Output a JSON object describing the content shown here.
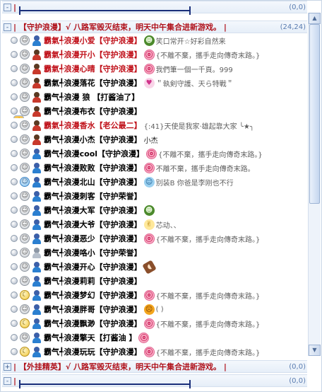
{
  "top_partial": {
    "count": "(0,0)"
  },
  "group1": {
    "expander": "-",
    "title": "| 【守护浪漫】√ 八路军毁灭结束，明天中午集合进新游戏。 |",
    "count": "(24,24)"
  },
  "members": [
    {
      "face": "grey",
      "avatar": "blue",
      "name": "霸氣╃浪漫小爱【守护浪漫】",
      "red": true,
      "icon": "green",
      "icon_glyph": "☻",
      "sig": "笑口常开☆好彩自然来"
    },
    {
      "face": "grey",
      "avatar": "dark",
      "name": "霸氣╃浪漫开小【守护浪漫】",
      "red": true,
      "icon": "pink",
      "icon_glyph": "ⓞ",
      "sig": "{不離不棄，攜手走向傳奇末路。}"
    },
    {
      "face": "grey",
      "avatar": "dark",
      "name": "霸氣╃浪漫心晴【守护浪漫】",
      "red": true,
      "icon": "pink",
      "icon_glyph": "ⓞ",
      "sig": "我們筆一個一千頁。999"
    },
    {
      "face": "grey",
      "avatar": "dark",
      "name": "霸氣╃浪漫落花【守护浪漫】",
      "red": false,
      "icon": "lolli",
      "icon_glyph": "♥",
      "sig": "＂執剣守護、天ら特戰＂"
    },
    {
      "face": "grey",
      "avatar": "dark",
      "name": "霸气╃浪漫 狼 【打酱油了】",
      "red": false,
      "icon": "",
      "icon_glyph": "",
      "sig": ""
    },
    {
      "face": "grey",
      "avatar": "dark",
      "name": "霸气╃浪漫布衣【守护浪漫】",
      "red": false,
      "icon": "thumb",
      "icon_glyph": "👍",
      "sig": ""
    },
    {
      "face": "grey",
      "avatar": "dark",
      "name": "霸氣╃浪漫香水【老公最二】",
      "red": true,
      "icon": "",
      "icon_glyph": "",
      "sig": "{:41}天使是我家·雄起靠大家 ╰★╮"
    },
    {
      "face": "grey",
      "avatar": "dark",
      "name": "霸气╃浪漫小杰【守护浪漫】",
      "red": false,
      "icon": "",
      "icon_glyph": "",
      "sig": "小杰"
    },
    {
      "face": "grey",
      "avatar": "blue",
      "name": "霸气╃浪漫cool【守护浪漫】",
      "red": false,
      "icon": "pink",
      "icon_glyph": "ⓞ",
      "sig": "{不離不棄，攜手走向傳奇末路。}"
    },
    {
      "face": "grey",
      "avatar": "blue",
      "name": "霸气╃浪漫败败【守护浪漫】",
      "red": false,
      "icon": "pink",
      "icon_glyph": "ⓞ",
      "sig": "不離不棄，攜手走向傳奇末路。"
    },
    {
      "face": "blue",
      "avatar": "blue",
      "name": "霸气╃浪漫北山【守护浪漫】",
      "red": false,
      "icon": "alien",
      "icon_glyph": "☺",
      "sig": "别装B 你爸是李刚也不行"
    },
    {
      "face": "grey",
      "avatar": "blue",
      "name": "霸气╃浪漫刺客【守护荣誉】",
      "red": false,
      "icon": "",
      "icon_glyph": "",
      "sig": ""
    },
    {
      "face": "grey",
      "avatar": "blue",
      "name": "霸气╃浪漫大军【守护浪漫】",
      "red": false,
      "icon": "green",
      "icon_glyph": "☻",
      "sig": ""
    },
    {
      "face": "grey",
      "avatar": "blue",
      "name": "霸气╃浪漫大爷【守护浪漫】",
      "red": false,
      "icon": "peace",
      "icon_glyph": "✌",
      "sig": "芯动、、"
    },
    {
      "face": "grey",
      "avatar": "blue",
      "name": "霸气╃浪漫恶少【守护浪漫】",
      "red": false,
      "icon": "pink",
      "icon_glyph": "ⓞ",
      "sig": "{不離不棄，攜手走向傳奇末路。}"
    },
    {
      "face": "grey",
      "avatar": "grey",
      "name": "霸气╃浪漫咯小【守护荣誉】",
      "red": false,
      "icon": "",
      "icon_glyph": "",
      "sig": ""
    },
    {
      "face": "grey",
      "avatar": "blue",
      "name": "霸气╃浪漫开心【守护浪漫】",
      "red": false,
      "icon": "choc",
      "icon_glyph": "◖",
      "sig": ""
    },
    {
      "face": "grey",
      "avatar": "blue",
      "name": "霸气╃浪漫莉莉【守护浪漫】",
      "red": false,
      "icon": "",
      "icon_glyph": "",
      "sig": ""
    },
    {
      "face": "moon",
      "avatar": "blue",
      "name": "霸气╃浪漫梦幻【守护浪漫】",
      "red": false,
      "icon": "pink",
      "icon_glyph": "ⓞ",
      "sig": "{不離不棄，攜手走向傳奇末路。}"
    },
    {
      "face": "grey",
      "avatar": "blue",
      "name": "霸气╃浪漫胖哥【守护浪漫】",
      "red": false,
      "icon": "orange",
      "icon_glyph": "☹",
      "sig": "(        )"
    },
    {
      "face": "moon",
      "avatar": "blue",
      "name": "霸气╃浪漫飘渺【守护浪漫】",
      "red": false,
      "icon": "pink",
      "icon_glyph": "ⓞ",
      "sig": "{不離不棄，攜手走向傳奇末路。}"
    },
    {
      "face": "grey",
      "avatar": "blue",
      "name": "霸气╃浪漫擎天【打酱油  】",
      "red": false,
      "icon": "pink",
      "icon_glyph": "ⓞ",
      "sig": ""
    },
    {
      "face": "moon",
      "avatar": "blue",
      "name": "霸气╃浪漫玩玩【守护浪漫】",
      "red": false,
      "icon": "pink",
      "icon_glyph": "ⓞ",
      "sig": "{不離不棄，攜手走向傳奇末路。}"
    }
  ],
  "group2": {
    "expander": "+",
    "title": "| 【外挂精英】√ 八路军毁灭结束，明天中午集合进新游戏。 |",
    "count": "(0,0)"
  },
  "bottom_group": {
    "expander": "-",
    "count": "(0,0)"
  },
  "scrollbar": {
    "up": "▲",
    "down": "▼"
  }
}
